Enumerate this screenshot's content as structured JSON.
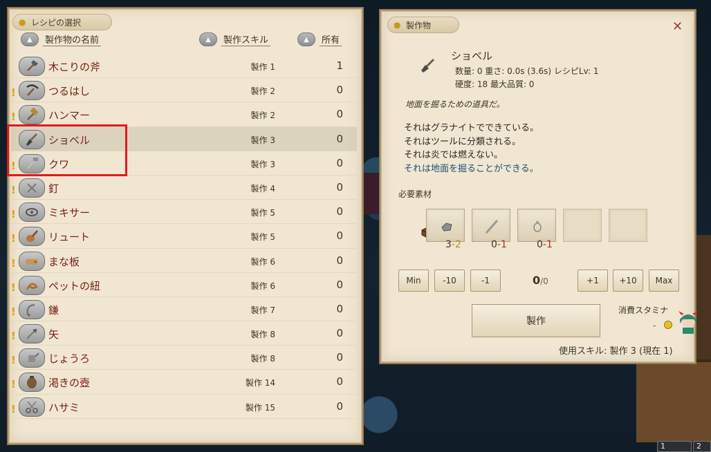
{
  "left_panel": {
    "title": "レシピの選択",
    "headers": {
      "name": "製作物の名前",
      "skill": "製作スキル",
      "owned": "所有"
    },
    "rows": [
      {
        "name": "木こりの斧",
        "skill": "製作 1",
        "owned": "1",
        "alert": false,
        "icon": "axe-icon",
        "selected": false
      },
      {
        "name": "つるはし",
        "skill": "製作 2",
        "owned": "0",
        "alert": true,
        "icon": "pickaxe-icon",
        "selected": false
      },
      {
        "name": "ハンマー",
        "skill": "製作 2",
        "owned": "0",
        "alert": true,
        "icon": "hammer-icon",
        "selected": false
      },
      {
        "name": "ショベル",
        "skill": "製作 3",
        "owned": "0",
        "alert": false,
        "icon": "shovel-icon",
        "selected": true
      },
      {
        "name": "クワ",
        "skill": "製作 3",
        "owned": "0",
        "alert": true,
        "icon": "hoe-icon",
        "selected": false
      },
      {
        "name": "釘",
        "skill": "製作 4",
        "owned": "0",
        "alert": true,
        "icon": "nail-icon",
        "selected": false
      },
      {
        "name": "ミキサー",
        "skill": "製作 5",
        "owned": "0",
        "alert": true,
        "icon": "mixer-icon",
        "selected": false
      },
      {
        "name": "リュート",
        "skill": "製作 5",
        "owned": "0",
        "alert": true,
        "icon": "lute-icon",
        "selected": false
      },
      {
        "name": "まな板",
        "skill": "製作 6",
        "owned": "0",
        "alert": true,
        "icon": "cutting-board-icon",
        "selected": false
      },
      {
        "name": "ペットの紐",
        "skill": "製作 6",
        "owned": "0",
        "alert": true,
        "icon": "leash-icon",
        "selected": false
      },
      {
        "name": "鎌",
        "skill": "製作 7",
        "owned": "0",
        "alert": true,
        "icon": "sickle-icon",
        "selected": false
      },
      {
        "name": "矢",
        "skill": "製作 8",
        "owned": "0",
        "alert": true,
        "icon": "arrow-icon",
        "selected": false
      },
      {
        "name": "じょうろ",
        "skill": "製作 8",
        "owned": "0",
        "alert": true,
        "icon": "watering-can-icon",
        "selected": false
      },
      {
        "name": "渇きの壺",
        "skill": "製作 14",
        "owned": "0",
        "alert": true,
        "icon": "pot-icon",
        "selected": false
      },
      {
        "name": "ハサミ",
        "skill": "製作 15",
        "owned": "0",
        "alert": true,
        "icon": "scissors-icon",
        "selected": false
      }
    ]
  },
  "right_panel": {
    "title": "製作物",
    "item_name": "ショベル",
    "stats_line1": "数量: 0  重さ: 0.0s (3.6s)  レシピLv: 1",
    "stats_line2": "硬度: 18  最大品質: 0",
    "description": "地面を掘るための道具だ。",
    "facts": [
      "それはグラナイトでできている。",
      "それはツールに分類される。",
      "それは炎では燃えない。"
    ],
    "fact_highlight": "それは地面を掘ることができる。",
    "materials_title": "必要素材",
    "materials": [
      {
        "have": "3",
        "need": "-2",
        "icon": "granite-icon"
      },
      {
        "have": "0",
        "need": "-1",
        "icon": "stick-icon"
      },
      {
        "have": "0",
        "need": "-1",
        "icon": "bag-icon"
      }
    ],
    "buttons": {
      "min": "Min",
      "minus10": "-10",
      "minus1": "-1",
      "plus1": "+1",
      "plus10": "+10",
      "max": "Max"
    },
    "count_value": "0",
    "count_max": "/0",
    "craft_label": "製作",
    "stamina_label": "消費スタミナ",
    "stamina_value": "-",
    "skill_used": "使用スキル: 製作 3 (現在 1)"
  },
  "hotbar": [
    "1",
    "2"
  ],
  "colors": {
    "item_name": "#7a1e14",
    "highlight": "#e01a1a",
    "blue_fact": "#1f4f76"
  }
}
